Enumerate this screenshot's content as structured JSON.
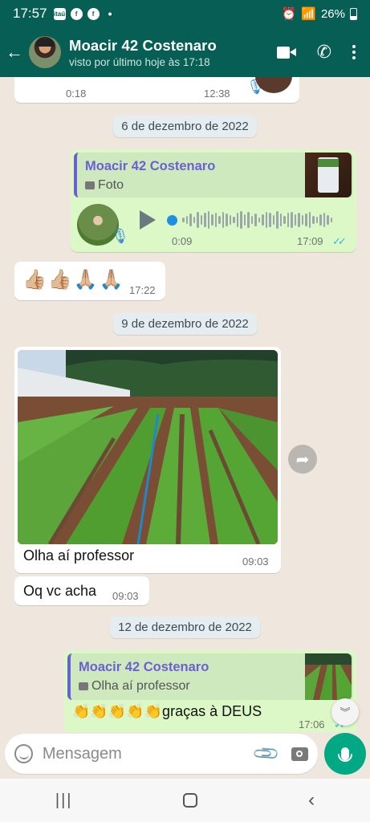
{
  "status_bar": {
    "time": "17:57",
    "battery": "26%"
  },
  "header": {
    "contact_name": "Moacir 42 Costenaro",
    "last_seen": "visto por último hoje às 17:18"
  },
  "messages": {
    "top_audio": {
      "duration": "0:18",
      "time": "12:38"
    },
    "date_1": "6 de dezembro de 2022",
    "reply_audio": {
      "quote_author": "Moacir 42 Costenaro",
      "quote_text": "Foto",
      "duration": "0:09",
      "time": "17:09"
    },
    "emoji_msg": {
      "text": "👍🏼👍🏼🙏🏼🙏🏼",
      "time": "17:22"
    },
    "date_2": "9 de dezembro de 2022",
    "photo_msg": {
      "caption": "Olha aí professor",
      "time": "09:03"
    },
    "text_msg": {
      "text": "Oq vc acha",
      "time": "09:03"
    },
    "date_3": "12 de dezembro de 2022",
    "reply_text": {
      "quote_author": "Moacir 42 Costenaro",
      "quote_text": "Olha aí professor",
      "text": "👏👏👏👏👏graças à DEUS",
      "time": "17:06"
    }
  },
  "input": {
    "placeholder": "Mensagem"
  },
  "colors": {
    "header": "#075e54",
    "outgoing": "#dcf8c6",
    "background": "#efe7dd",
    "accent": "#00a884",
    "quote_author": "#6b5fd3",
    "read_ticks": "#34b7f1"
  }
}
